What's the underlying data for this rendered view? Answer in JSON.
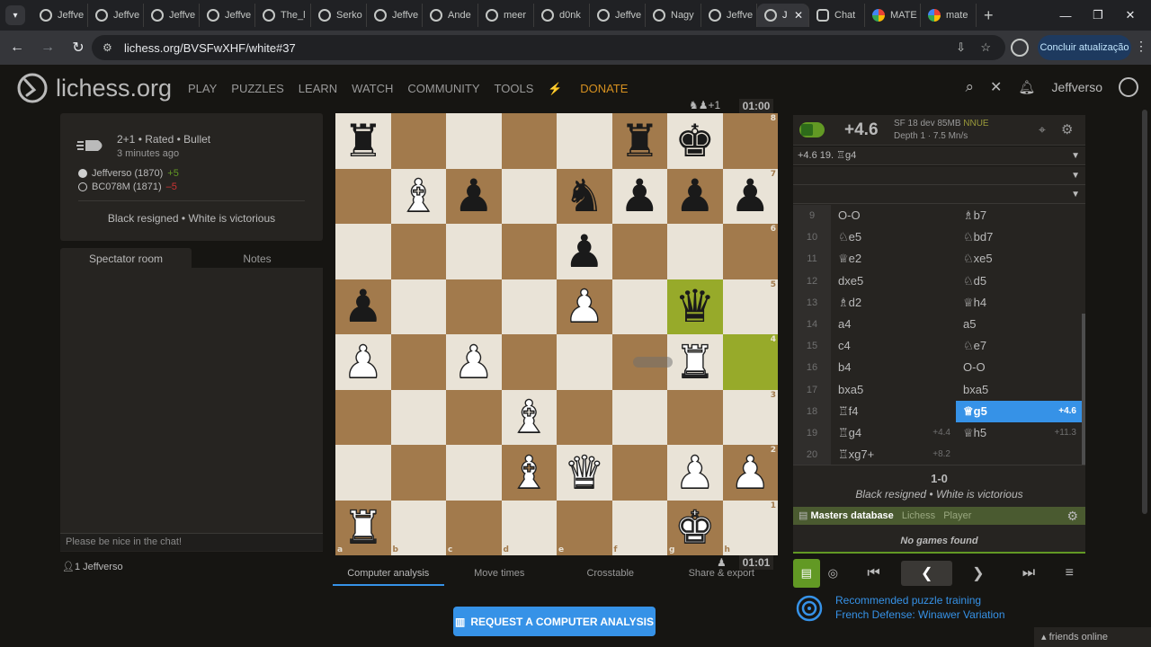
{
  "browser": {
    "tabs": [
      {
        "title": "Jeffve",
        "favicon": "lichess-icon"
      },
      {
        "title": "Jeffve",
        "favicon": "lichess-icon"
      },
      {
        "title": "Jeffve",
        "favicon": "lichess-icon"
      },
      {
        "title": "Jeffve",
        "favicon": "lichess-icon"
      },
      {
        "title": "The_l",
        "favicon": "lichess-icon"
      },
      {
        "title": "Serko",
        "favicon": "lichess-icon"
      },
      {
        "title": "Jeffve",
        "favicon": "lichess-icon"
      },
      {
        "title": "Ande",
        "favicon": "lichess-icon"
      },
      {
        "title": "meer",
        "favicon": "lichess-icon"
      },
      {
        "title": "d0nk",
        "favicon": "lichess-icon"
      },
      {
        "title": "Jeffve",
        "favicon": "lichess-icon"
      },
      {
        "title": "Nagy",
        "favicon": "lichess-icon"
      },
      {
        "title": "Jeffve",
        "favicon": "lichess-icon"
      }
    ],
    "active_tab": {
      "title": "J",
      "close": "✕"
    },
    "extra_tabs": [
      {
        "title": "Chat",
        "favicon": "chatgpt-icon"
      },
      {
        "title": "MATE",
        "favicon": "google-icon"
      },
      {
        "title": "mate",
        "favicon": "google-icon"
      }
    ],
    "new_tab": "+",
    "url": "lichess.org/BVSFwXHF/white#37",
    "update_label": "Concluir atualização"
  },
  "header": {
    "logo": "lichess.org",
    "nav": [
      "PLAY",
      "PUZZLES",
      "LEARN",
      "WATCH",
      "COMMUNITY",
      "TOOLS"
    ],
    "donate": "DONATE",
    "username": "Jeffverso"
  },
  "game": {
    "time_control": "2+1 • Rated • Bullet",
    "when": "3 minutes ago",
    "white": {
      "name": "Jeffverso (1870)",
      "diff": "+5"
    },
    "black": {
      "name": "BC078M (1871)",
      "diff": "–5"
    },
    "result_text": "Black resigned • White is victorious"
  },
  "chat": {
    "tabs": [
      "Spectator room",
      "Notes"
    ],
    "placeholder": "Please be nice in the chat!",
    "watchers": "1  Jeffverso"
  },
  "board": {
    "material_top": "+1",
    "clock_top": "01:00",
    "clock_bottom": "01:01",
    "files": [
      "a",
      "b",
      "c",
      "d",
      "e",
      "f",
      "g",
      "h"
    ],
    "ranks": [
      "8",
      "7",
      "6",
      "5",
      "4",
      "3",
      "2",
      "1"
    ],
    "highlight": [
      "g5",
      "h4"
    ],
    "position": {
      "a8": "br",
      "f8": "br",
      "g8": "bk",
      "b7": "wb",
      "c7": "bp",
      "e7": "bn",
      "f7": "bp",
      "g7": "bp",
      "h7": "bp",
      "e6": "bp",
      "a5": "bp",
      "e5": "wp",
      "g5": "bq",
      "a4": "wp",
      "c4": "wp",
      "g4": "wr",
      "d3": "wb",
      "d2": "wb",
      "e2": "wq",
      "g2": "wp",
      "h2": "wp",
      "a1": "wr",
      "g1": "wk"
    }
  },
  "under_board_tabs": [
    "Computer analysis",
    "Move times",
    "Crosstable",
    "Share & export"
  ],
  "analysis_button": "REQUEST A COMPUTER ANALYSIS",
  "ceval": {
    "score": "+4.6",
    "engine": "SF 18 dev 85MB",
    "nnue": "NNUE",
    "info": "Depth 1 · 7.5 Mn/s",
    "pv1": "+4.6  19. ♖g4"
  },
  "moves": [
    {
      "n": "9",
      "w": "O-O",
      "b": "♗b7",
      "we": "",
      "be": ""
    },
    {
      "n": "10",
      "w": "♘e5",
      "b": "♘bd7",
      "we": "",
      "be": ""
    },
    {
      "n": "11",
      "w": "♕e2",
      "b": "♘xe5",
      "we": "",
      "be": ""
    },
    {
      "n": "12",
      "w": "dxe5",
      "b": "♘d5",
      "we": "",
      "be": ""
    },
    {
      "n": "13",
      "w": "♗d2",
      "b": "♕h4",
      "we": "",
      "be": ""
    },
    {
      "n": "14",
      "w": "a4",
      "b": "a5",
      "we": "",
      "be": ""
    },
    {
      "n": "15",
      "w": "c4",
      "b": "♘e7",
      "we": "",
      "be": ""
    },
    {
      "n": "16",
      "w": "b4",
      "b": "O-O",
      "we": "",
      "be": ""
    },
    {
      "n": "17",
      "w": "bxa5",
      "b": "bxa5",
      "we": "",
      "be": ""
    },
    {
      "n": "18",
      "w": "♖f4",
      "b": "♕g5",
      "we": "",
      "be": "+4.6"
    },
    {
      "n": "19",
      "w": "♖g4",
      "b": "♕h5",
      "we": "+4.4",
      "be": "+11.3"
    },
    {
      "n": "20",
      "w": "♖xg7+",
      "b": "",
      "we": "+8.2",
      "be": ""
    }
  ],
  "active_move": {
    "row": 9,
    "side": "b"
  },
  "result": {
    "score": "1-0",
    "text": "Black resigned • White is victorious"
  },
  "explorer": {
    "db": "Masters database",
    "options": [
      "Lichess",
      "Player"
    ],
    "empty": "No games found"
  },
  "puzzle": {
    "line1": "Recommended puzzle training",
    "line2": "French Defense: Winawer Variation"
  },
  "friends": "friends online",
  "colors": {
    "accent": "#3692e7",
    "good": "#629924",
    "bad": "#cc3333",
    "donate": "#d59020",
    "highlight": "#c6d258"
  }
}
